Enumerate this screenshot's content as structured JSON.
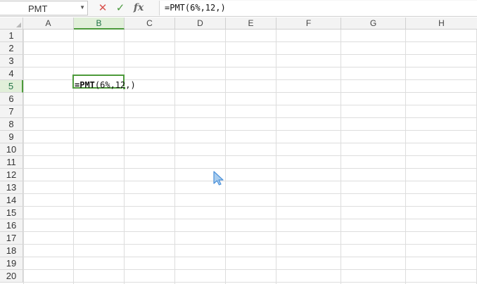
{
  "formula_bar": {
    "name_box": "PMT",
    "cancel_icon": "✕",
    "enter_icon": "✓",
    "fx_label": "fx",
    "formula": "=PMT(6%,12,)"
  },
  "columns": [
    "A",
    "B",
    "C",
    "D",
    "E",
    "F",
    "G",
    "H"
  ],
  "rows": [
    "1",
    "2",
    "3",
    "4",
    "5",
    "6",
    "7",
    "8",
    "9",
    "10",
    "11",
    "12",
    "13",
    "14",
    "15",
    "16",
    "17",
    "18",
    "19",
    "20"
  ],
  "active_cell": {
    "column": "B",
    "row": "5",
    "editing_prefix": "=PMT",
    "editing_args": "(6%,12,)"
  },
  "colors": {
    "selection": "#4c9a3a",
    "cancel": "#d9534f",
    "enter": "#4a9a3e",
    "cursor": "#4a90d9"
  }
}
